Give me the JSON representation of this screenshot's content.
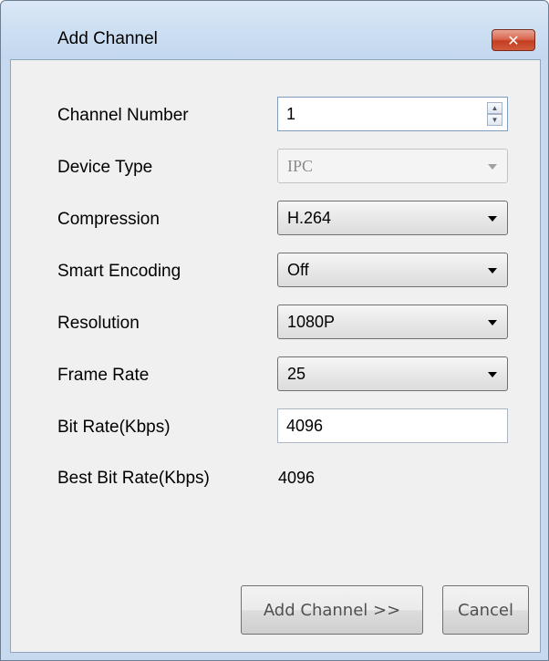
{
  "window": {
    "title": "Add Channel",
    "close_glyph": "✕"
  },
  "form": {
    "channel_number": {
      "label": "Channel Number",
      "value": "1"
    },
    "device_type": {
      "label": "Device Type",
      "value": "IPC",
      "disabled": true
    },
    "compression": {
      "label": "Compression",
      "value": "H.264"
    },
    "smart_encoding": {
      "label": "Smart Encoding",
      "value": "Off"
    },
    "resolution": {
      "label": "Resolution",
      "value": "1080P"
    },
    "frame_rate": {
      "label": "Frame Rate",
      "value": "25"
    },
    "bit_rate": {
      "label": "Bit Rate(Kbps)",
      "value": "4096"
    },
    "best_bit_rate": {
      "label": "Best Bit Rate(Kbps)",
      "value": "4096"
    }
  },
  "buttons": {
    "add_channel": "Add Channel >>",
    "cancel": "Cancel"
  },
  "colors": {
    "title_bar": "#c6d9ee",
    "close_button": "#c33e21",
    "client_bg": "#f0f0f0"
  }
}
